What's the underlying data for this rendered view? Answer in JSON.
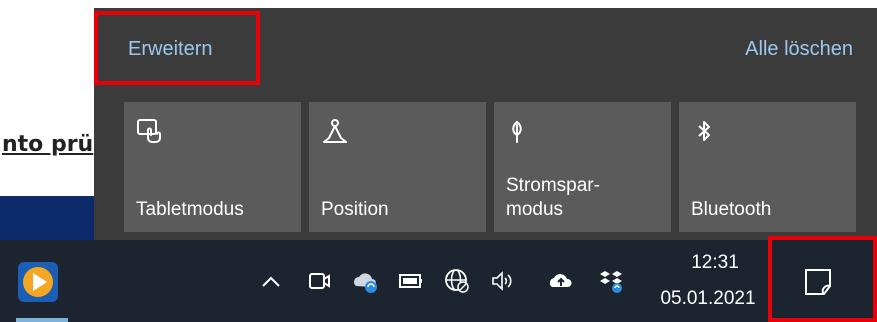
{
  "background_page": {
    "link_text": "nto prü"
  },
  "action_center": {
    "expand_label": "Erweitern",
    "clear_all_label": "Alle löschen",
    "tiles": [
      {
        "label": "Tabletmodus",
        "icon": "tablet-mode-icon"
      },
      {
        "label": "Position",
        "icon": "location-icon"
      },
      {
        "label": "Stromspar-\nmodus",
        "icon": "battery-saver-icon"
      },
      {
        "label": "Bluetooth",
        "icon": "bluetooth-icon"
      }
    ]
  },
  "taskbar": {
    "clock_time": "12:31",
    "clock_date": "05.01.2021",
    "tray_icons": [
      "chevron-up-icon",
      "meet-now-icon",
      "onedrive-sync-icon",
      "battery-icon",
      "network-icon",
      "volume-icon",
      "cloud-upload-icon",
      "dropbox-icon"
    ]
  },
  "colors": {
    "panel_bg": "#3b3b3b",
    "tile_bg": "#5b5b5b",
    "link": "#9cc8ee",
    "taskbar_bg": "#1c2430",
    "highlight": "#e8000b"
  }
}
